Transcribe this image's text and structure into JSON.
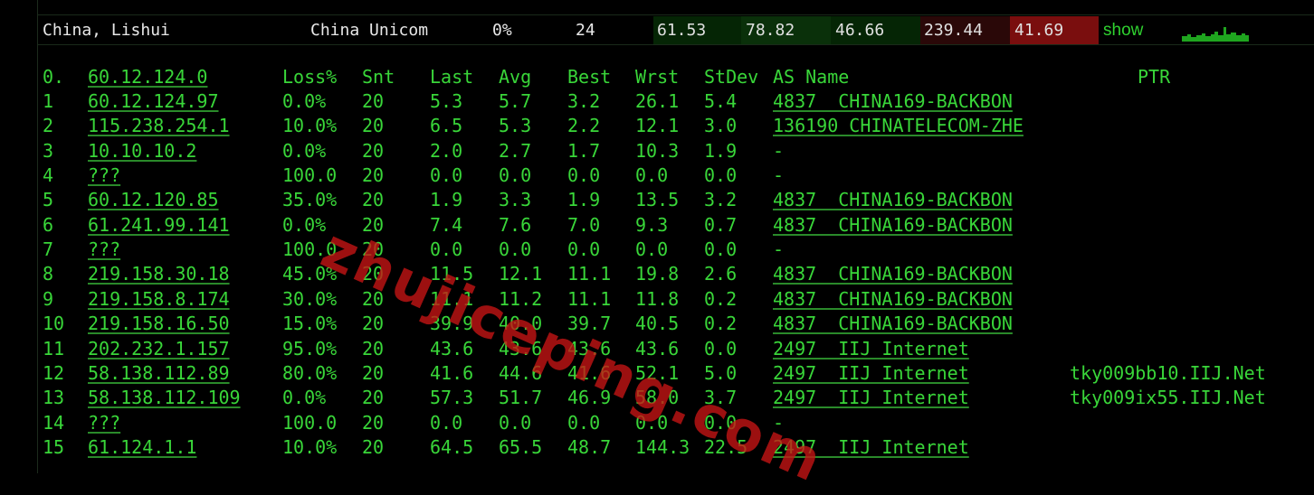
{
  "summary": {
    "location": "China, Lishui",
    "isp": "China Unicom",
    "loss": "0%",
    "sent": "24",
    "last": "61.53",
    "avg": "78.82",
    "best": "46.66",
    "worst": "239.44",
    "stdev": "41.69",
    "show_label": "show"
  },
  "header": {
    "index": "0.",
    "target": "60.12.124.0",
    "loss": "Loss%",
    "snt": "Snt",
    "last": "Last",
    "avg": "Avg",
    "best": "Best",
    "wrst": "Wrst",
    "stdev": "StDev",
    "asname": "AS Name",
    "ptr": "PTR"
  },
  "hops": [
    {
      "n": "1",
      "host": "60.12.124.97",
      "loss": "0.0%",
      "snt": "20",
      "last": "5.3",
      "avg": "5.7",
      "best": "3.2",
      "wrst": "26.1",
      "stdev": "5.4",
      "as": "4837  CHINA169-BACKBON",
      "ptr": ""
    },
    {
      "n": "2",
      "host": "115.238.254.1",
      "loss": "10.0%",
      "snt": "20",
      "last": "6.5",
      "avg": "5.3",
      "best": "2.2",
      "wrst": "12.1",
      "stdev": "3.0",
      "as": "136190 CHINATELECOM-ZHE",
      "ptr": ""
    },
    {
      "n": "3",
      "host": "10.10.10.2",
      "loss": "0.0%",
      "snt": "20",
      "last": "2.0",
      "avg": "2.7",
      "best": "1.7",
      "wrst": "10.3",
      "stdev": "1.9",
      "as": "-",
      "ptr": ""
    },
    {
      "n": "4",
      "host": "???",
      "loss": "100.0",
      "snt": "20",
      "last": "0.0",
      "avg": "0.0",
      "best": "0.0",
      "wrst": "0.0",
      "stdev": "0.0",
      "as": "-",
      "ptr": ""
    },
    {
      "n": "5",
      "host": "60.12.120.85",
      "loss": "35.0%",
      "snt": "20",
      "last": "1.9",
      "avg": "3.3",
      "best": "1.9",
      "wrst": "13.5",
      "stdev": "3.2",
      "as": "4837  CHINA169-BACKBON",
      "ptr": ""
    },
    {
      "n": "6",
      "host": "61.241.99.141",
      "loss": "0.0%",
      "snt": "20",
      "last": "7.4",
      "avg": "7.6",
      "best": "7.0",
      "wrst": "9.3",
      "stdev": "0.7",
      "as": "4837  CHINA169-BACKBON",
      "ptr": ""
    },
    {
      "n": "7",
      "host": "???",
      "loss": "100.0",
      "snt": "20",
      "last": "0.0",
      "avg": "0.0",
      "best": "0.0",
      "wrst": "0.0",
      "stdev": "0.0",
      "as": "-",
      "ptr": ""
    },
    {
      "n": "8",
      "host": "219.158.30.18",
      "loss": "45.0%",
      "snt": "20",
      "last": "11.5",
      "avg": "12.1",
      "best": "11.1",
      "wrst": "19.8",
      "stdev": "2.6",
      "as": "4837  CHINA169-BACKBON",
      "ptr": ""
    },
    {
      "n": "9",
      "host": "219.158.8.174",
      "loss": "30.0%",
      "snt": "20",
      "last": "11.1",
      "avg": "11.2",
      "best": "11.1",
      "wrst": "11.8",
      "stdev": "0.2",
      "as": "4837  CHINA169-BACKBON",
      "ptr": ""
    },
    {
      "n": "10",
      "host": "219.158.16.50",
      "loss": "15.0%",
      "snt": "20",
      "last": "39.9",
      "avg": "40.0",
      "best": "39.7",
      "wrst": "40.5",
      "stdev": "0.2",
      "as": "4837  CHINA169-BACKBON",
      "ptr": ""
    },
    {
      "n": "11",
      "host": "202.232.1.157",
      "loss": "95.0%",
      "snt": "20",
      "last": "43.6",
      "avg": "43.6",
      "best": "43.6",
      "wrst": "43.6",
      "stdev": "0.0",
      "as": "2497  IIJ Internet",
      "ptr": ""
    },
    {
      "n": "12",
      "host": "58.138.112.89",
      "loss": "80.0%",
      "snt": "20",
      "last": "41.6",
      "avg": "44.6",
      "best": "41.6",
      "wrst": "52.1",
      "stdev": "5.0",
      "as": "2497  IIJ Internet",
      "ptr": "tky009bb10.IIJ.Net"
    },
    {
      "n": "13",
      "host": "58.138.112.109",
      "loss": "0.0%",
      "snt": "20",
      "last": "57.3",
      "avg": "51.7",
      "best": "46.9",
      "wrst": "58.0",
      "stdev": "3.7",
      "as": "2497  IIJ Internet",
      "ptr": "tky009ix55.IIJ.Net"
    },
    {
      "n": "14",
      "host": "???",
      "loss": "100.0",
      "snt": "20",
      "last": "0.0",
      "avg": "0.0",
      "best": "0.0",
      "wrst": "0.0",
      "stdev": "0.0",
      "as": "-",
      "ptr": ""
    },
    {
      "n": "15",
      "host": "61.124.1.1",
      "loss": "10.0%",
      "snt": "20",
      "last": "64.5",
      "avg": "65.5",
      "best": "48.7",
      "wrst": "144.3",
      "stdev": "22.5",
      "as": "2497  IIJ Internet",
      "ptr": ""
    }
  ],
  "watermark": "zhujiceping.com"
}
